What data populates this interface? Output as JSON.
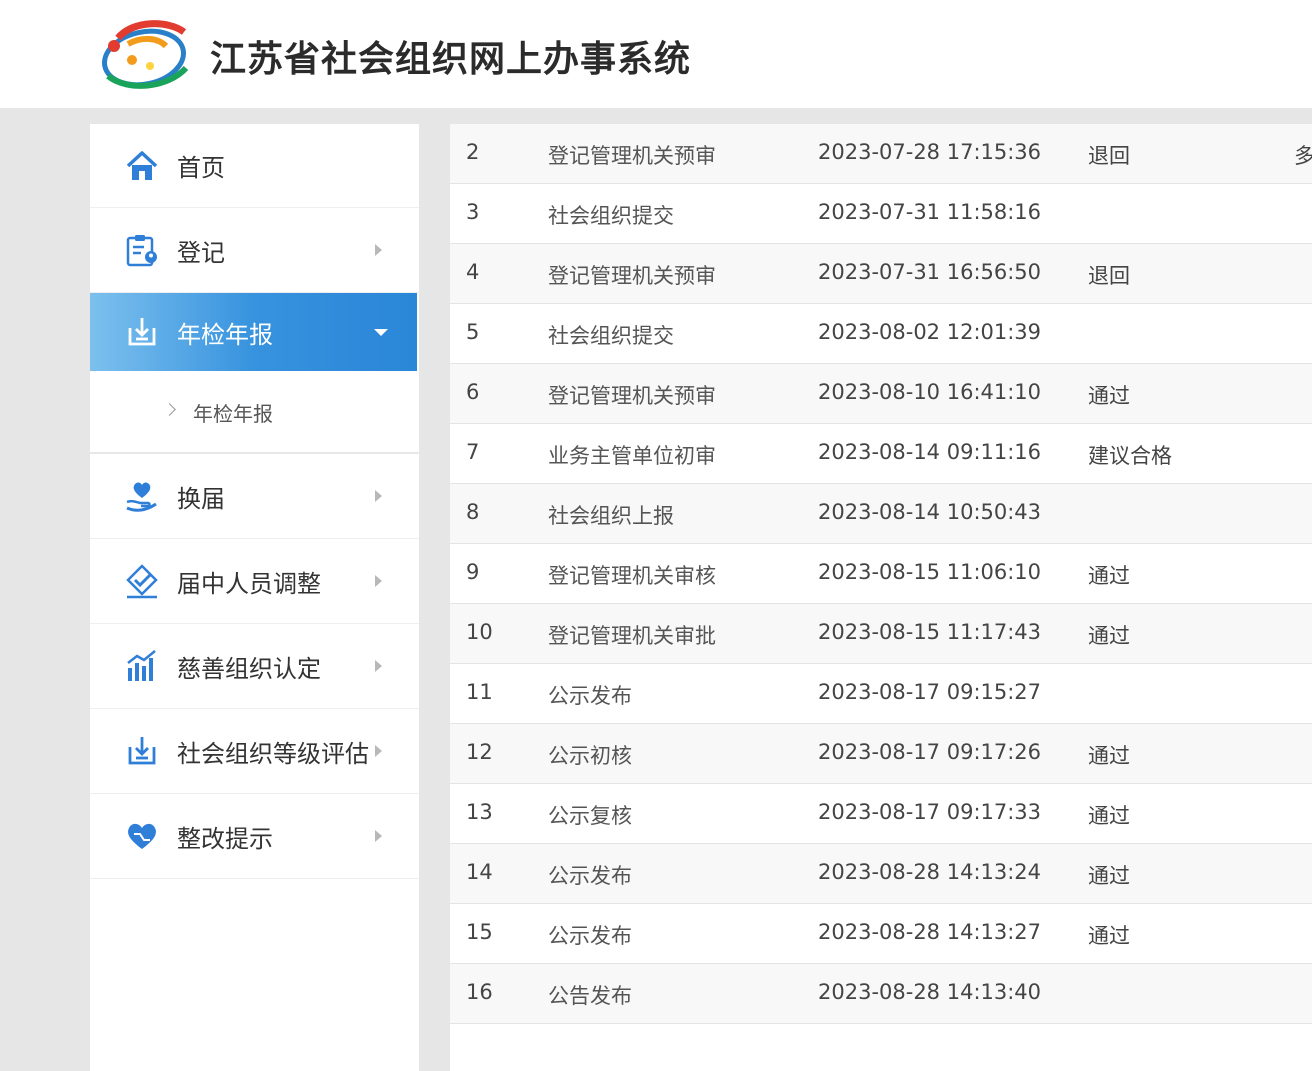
{
  "header": {
    "title": "江苏省社会组织网上办事系统"
  },
  "sidebar": {
    "items": [
      {
        "label": "首页",
        "icon": "home-icon"
      },
      {
        "label": "登记",
        "icon": "clipboard-user-icon"
      },
      {
        "label": "年检年报",
        "icon": "download-tray-icon",
        "sub": [
          "年检年报"
        ]
      },
      {
        "label": "换届",
        "icon": "hand-heart-icon"
      },
      {
        "label": "届中人员调整",
        "icon": "check-diamond-icon"
      },
      {
        "label": "慈善组织认定",
        "icon": "bar-chart-icon"
      },
      {
        "label": "社会组织等级评估",
        "icon": "download-tray-icon"
      },
      {
        "label": "整改提示",
        "icon": "heart-icon"
      }
    ]
  },
  "table": {
    "rows": [
      {
        "no": "2",
        "step": "登记管理机关预审",
        "time": "2023-07-28 17:15:36",
        "result": "退回",
        "edge": "多"
      },
      {
        "no": "3",
        "step": "社会组织提交",
        "time": "2023-07-31 11:58:16",
        "result": "",
        "edge": ""
      },
      {
        "no": "4",
        "step": "登记管理机关预审",
        "time": "2023-07-31 16:56:50",
        "result": "退回",
        "edge": ""
      },
      {
        "no": "5",
        "step": "社会组织提交",
        "time": "2023-08-02 12:01:39",
        "result": "",
        "edge": ""
      },
      {
        "no": "6",
        "step": "登记管理机关预审",
        "time": "2023-08-10 16:41:10",
        "result": "通过",
        "edge": ""
      },
      {
        "no": "7",
        "step": "业务主管单位初审",
        "time": "2023-08-14 09:11:16",
        "result": "建议合格",
        "edge": ""
      },
      {
        "no": "8",
        "step": "社会组织上报",
        "time": "2023-08-14 10:50:43",
        "result": "",
        "edge": ""
      },
      {
        "no": "9",
        "step": "登记管理机关审核",
        "time": "2023-08-15 11:06:10",
        "result": "通过",
        "edge": ""
      },
      {
        "no": "10",
        "step": "登记管理机关审批",
        "time": "2023-08-15 11:17:43",
        "result": "通过",
        "edge": ""
      },
      {
        "no": "11",
        "step": "公示发布",
        "time": "2023-08-17 09:15:27",
        "result": "",
        "edge": ""
      },
      {
        "no": "12",
        "step": "公示初核",
        "time": "2023-08-17 09:17:26",
        "result": "通过",
        "edge": ""
      },
      {
        "no": "13",
        "step": "公示复核",
        "time": "2023-08-17 09:17:33",
        "result": "通过",
        "edge": ""
      },
      {
        "no": "14",
        "step": "公示发布",
        "time": "2023-08-28 14:13:24",
        "result": "通过",
        "edge": ""
      },
      {
        "no": "15",
        "step": "公示发布",
        "time": "2023-08-28 14:13:27",
        "result": "通过",
        "edge": ""
      },
      {
        "no": "16",
        "step": "公告发布",
        "time": "2023-08-28 14:13:40",
        "result": "",
        "edge": ""
      }
    ]
  },
  "colors": {
    "accent": "#2a86d7",
    "icon_blue": "#2f7fd8",
    "page_bg": "#e6e6e6"
  }
}
